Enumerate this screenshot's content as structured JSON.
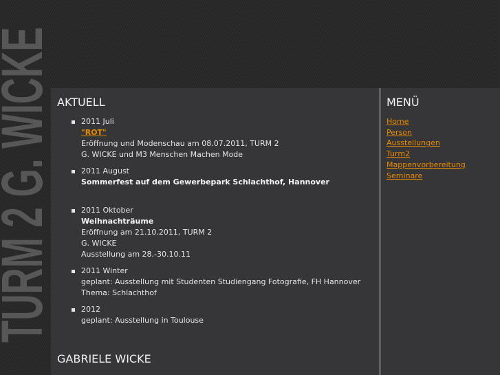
{
  "logo_text": "TURM 2 G. WICKE",
  "main": {
    "heading": "AKTUELL",
    "items": [
      {
        "date": "2011 Juli",
        "title": "\"ROT\"",
        "lines": [
          "Eröffnung und Modenschau am 08.07.2011, TURM 2",
          "G. WICKE und M3 Menschen Machen Mode"
        ]
      },
      {
        "date": "2011 August",
        "title": "Sommerfest auf dem Gewerbepark Schlachthof, Hannover"
      },
      {
        "date": "2011 Oktober",
        "title": "Weihnachträume",
        "lines": [
          "Eröffnung am 21.10.2011, TURM 2",
          "G. WICKE",
          "Ausstellung am 28.-30.10.11"
        ]
      },
      {
        "date": "2011 Winter",
        "lines": [
          "geplant: Ausstellung mit Studenten Studiengang Fotografie, FH Hannover",
          "Thema: Schlachthof"
        ]
      },
      {
        "date": "2012",
        "lines": [
          "geplant: Ausstellung in Toulouse"
        ]
      }
    ],
    "heading2": "GABRIELE WICKE"
  },
  "sidebar": {
    "heading": "MENÜ",
    "items": [
      "Home",
      "Person",
      "Ausstellungen",
      "Turm2",
      "Mappenvorbereitung",
      "Seminare"
    ]
  },
  "colors": {
    "link": "#e88a00",
    "panel": "#363638"
  }
}
